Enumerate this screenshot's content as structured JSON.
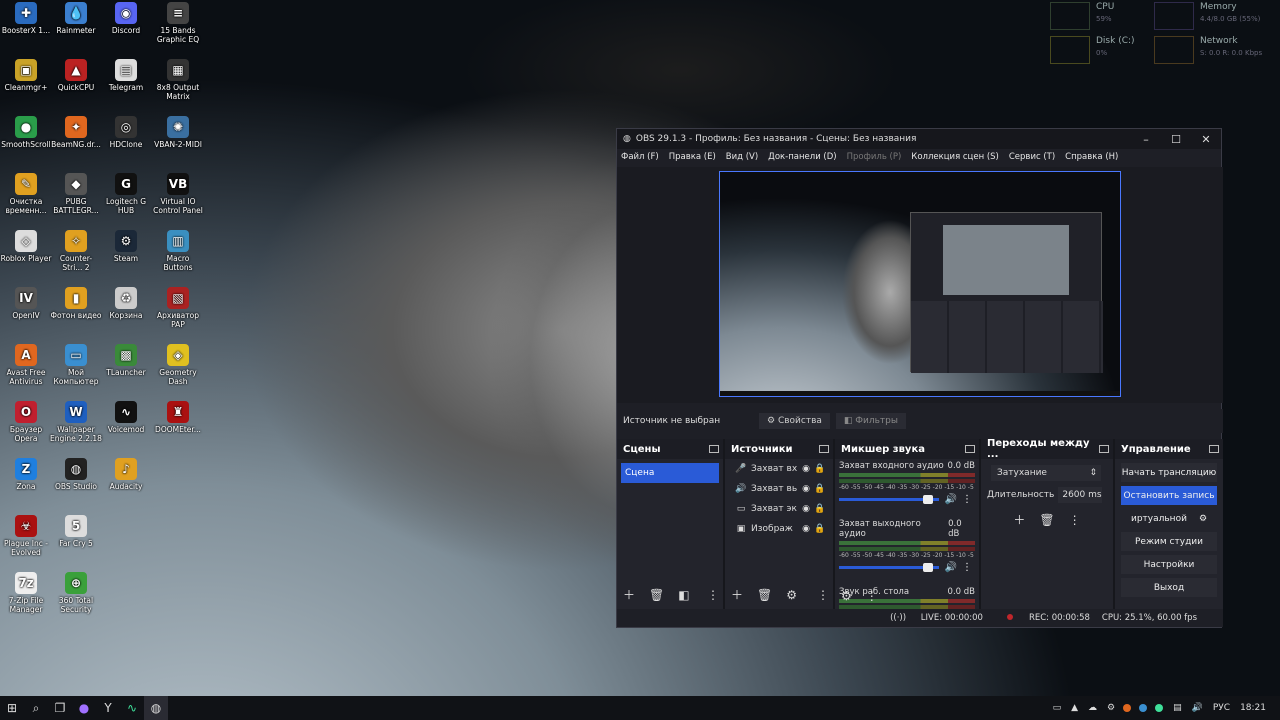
{
  "desktop_icons": [
    {
      "label": "BoosterX 1...",
      "color": "#2a6bbf",
      "glyph": "✚"
    },
    {
      "label": "Rainmeter",
      "color": "#3b7fcf",
      "glyph": "💧"
    },
    {
      "label": "Discord",
      "color": "#5865f2",
      "glyph": "◉"
    },
    {
      "label": "15 Bands Graphic EQ",
      "color": "#444",
      "glyph": "≡"
    },
    {
      "label": "Cleanmgr+",
      "color": "#c9a227",
      "glyph": "▣"
    },
    {
      "label": "QuickCPU",
      "color": "#b22",
      "glyph": "▲"
    },
    {
      "label": "Telegram",
      "color": "#ddd",
      "glyph": "▤"
    },
    {
      "label": "8x8 Output Matrix",
      "color": "#333",
      "glyph": "▦"
    },
    {
      "label": "SmoothScroll",
      "color": "#2a9d4a",
      "glyph": "●"
    },
    {
      "label": "BeamNG.dr...",
      "color": "#e0671f",
      "glyph": "✦"
    },
    {
      "label": "HDClone",
      "color": "#333",
      "glyph": "◎"
    },
    {
      "label": "VBAN-2-MIDI",
      "color": "#3a6fa0",
      "glyph": "✺"
    },
    {
      "label": "Очистка временн...",
      "color": "#e0a020",
      "glyph": "✎"
    },
    {
      "label": "PUBG BATTLEGR...",
      "color": "#555",
      "glyph": "◆"
    },
    {
      "label": "Logitech G HUB",
      "color": "#111",
      "glyph": "G"
    },
    {
      "label": "Virtual IO Control Panel",
      "color": "#111",
      "glyph": "VB"
    },
    {
      "label": "Roblox Player",
      "color": "#ddd",
      "glyph": "◇"
    },
    {
      "label": "Counter-Stri... 2",
      "color": "#e0a020",
      "glyph": "✧"
    },
    {
      "label": "Steam",
      "color": "#1b2838",
      "glyph": "⚙"
    },
    {
      "label": "Macro Buttons",
      "color": "#3a8fc0",
      "glyph": "▥"
    },
    {
      "label": "OpenIV",
      "color": "#555",
      "glyph": "IV"
    },
    {
      "label": "Фотон видео",
      "color": "#e0a020",
      "glyph": "▮"
    },
    {
      "label": "Корзина",
      "color": "#ccc",
      "glyph": "♻"
    },
    {
      "label": "Архиватор PAP",
      "color": "#a22",
      "glyph": "▧"
    },
    {
      "label": "Avast Free Antivirus",
      "color": "#e0671f",
      "glyph": "A"
    },
    {
      "label": "Мой Компьютер",
      "color": "#3a8fd0",
      "glyph": "▭"
    },
    {
      "label": "TLauncher",
      "color": "#3a8a3a",
      "glyph": "▩"
    },
    {
      "label": "Geometry Dash",
      "color": "#e0c020",
      "glyph": "◈"
    },
    {
      "label": "Браузер Opera",
      "color": "#c01f2f",
      "glyph": "O"
    },
    {
      "label": "Wallpaper Engine 2.2.18",
      "color": "#1f5fbf",
      "glyph": "W"
    },
    {
      "label": "Voicemod",
      "color": "#111",
      "glyph": "∿"
    },
    {
      "label": "DOOMEter...",
      "color": "#a11",
      "glyph": "♜"
    },
    {
      "label": "Zona",
      "color": "#1f7fdf",
      "glyph": "Z"
    },
    {
      "label": "OBS Studio",
      "color": "#222",
      "glyph": "◍"
    },
    {
      "label": "Audacity",
      "color": "#e0a020",
      "glyph": "♪"
    },
    {
      "label": "Plague Inc - Evolved",
      "color": "#a11",
      "glyph": "☣"
    },
    {
      "label": "Far Cry 5",
      "color": "#ddd",
      "glyph": "5"
    },
    {
      "label": "7-Zip File Manager",
      "color": "#eee",
      "glyph": "7z"
    },
    {
      "label": "360 Total Security",
      "color": "#3aa03a",
      "glyph": "⊕"
    }
  ],
  "widget": {
    "cpu_title": "CPU",
    "cpu_value": "59%",
    "mem_title": "Memory",
    "mem_value": "4.4/8.0 GB (55%)",
    "disk_title": "Disk (C:)",
    "disk_value": "0%",
    "net_title": "Network",
    "net_value": "S: 0.0 R: 0.0 Kbps"
  },
  "obs": {
    "title": "OBS 29.1.3 - Профиль: Без названия - Сцены: Без названия",
    "menu": [
      {
        "label": "Файл (F)",
        "dim": false
      },
      {
        "label": "Правка (E)",
        "dim": false
      },
      {
        "label": "Вид (V)",
        "dim": false
      },
      {
        "label": "Док-панели (D)",
        "dim": false
      },
      {
        "label": "Профиль (P)",
        "dim": true
      },
      {
        "label": "Коллекция сцен (S)",
        "dim": false
      },
      {
        "label": "Сервис (T)",
        "dim": false
      },
      {
        "label": "Справка (H)",
        "dim": false
      }
    ],
    "no_source": "Источник не выбран",
    "properties": "Свойства",
    "filters": "Фильтры",
    "scenes": {
      "title": "Сцены",
      "items": [
        "Сцена"
      ]
    },
    "sources": {
      "title": "Источники",
      "items": [
        {
          "icon": "🎤",
          "label": "Захват вх"
        },
        {
          "icon": "🔊",
          "label": "Захват вь"
        },
        {
          "icon": "▭",
          "label": "Захват эк"
        },
        {
          "icon": "▣",
          "label": "Изображ"
        }
      ]
    },
    "mixer": {
      "title": "Микшер звука",
      "channels": [
        {
          "name": "Захват входного аудио",
          "db": "0.0 dB"
        },
        {
          "name": "Захват выходного аудио",
          "db": "0.0 dB"
        },
        {
          "name": "Звук раб. стола",
          "db": "0.0 dB"
        }
      ],
      "scale": "-60 -55 -50 -45 -40 -35 -30 -25 -20 -15 -10 -5 0"
    },
    "transitions": {
      "title": "Переходы между ...",
      "type": "Затухание",
      "duration_label": "Длительность",
      "duration": "2600 ms"
    },
    "controls": {
      "title": "Управление",
      "buttons": [
        {
          "label": "Начать трансляцию",
          "active": false
        },
        {
          "label": "Остановить запись",
          "active": true
        },
        {
          "label": "иртуальной",
          "active": false
        },
        {
          "label": "Режим студии",
          "active": false
        },
        {
          "label": "Настройки",
          "active": false
        },
        {
          "label": "Выход",
          "active": false
        }
      ]
    },
    "status": {
      "live": "LIVE: 00:00:00",
      "rec": "REC: 00:00:58",
      "cpu": "CPU: 25.1%, 60.00 fps"
    }
  },
  "taskbar": {
    "lang": "РУС",
    "time": "18:21"
  },
  "colors": {
    "accent": "#2a5bd7",
    "dock_bg": "#23242c",
    "window_bg": "#1e1f26",
    "rec": "#c0262b"
  }
}
